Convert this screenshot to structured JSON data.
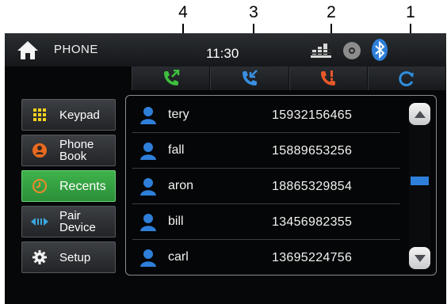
{
  "callouts": [
    {
      "number": "4",
      "target": "tab-dialed-calls"
    },
    {
      "number": "3",
      "target": "tab-received-calls"
    },
    {
      "number": "2",
      "target": "tab-missed-calls"
    },
    {
      "number": "1",
      "target": "tab-refresh"
    }
  ],
  "header": {
    "title": "PHONE",
    "time": "11:30",
    "icons": [
      "home-icon",
      "signal-icon",
      "disc-icon",
      "bluetooth-icon"
    ]
  },
  "tabs": [
    {
      "icon": "dialed-call-icon",
      "color": "#3fbf3f"
    },
    {
      "icon": "received-call-icon",
      "color": "#3a8fe0"
    },
    {
      "icon": "missed-call-icon",
      "color": "#e8582a"
    },
    {
      "icon": "refresh-icon",
      "color": "#2f8fe0"
    }
  ],
  "sidebar": {
    "items": [
      {
        "label": "Keypad",
        "icon": "keypad-icon",
        "active": false
      },
      {
        "label": "Phone\nBook",
        "icon": "phonebook-icon",
        "active": false
      },
      {
        "label": "Recents",
        "icon": "clock-icon",
        "active": true
      },
      {
        "label": "Pair\nDevice",
        "icon": "pair-icon",
        "active": false
      },
      {
        "label": "Setup",
        "icon": "gear-icon",
        "active": false
      }
    ]
  },
  "contacts": [
    {
      "name": "tery",
      "number": "15932156465"
    },
    {
      "name": "fall",
      "number": "15889653256"
    },
    {
      "name": "aron",
      "number": "18865329854"
    },
    {
      "name": "bill",
      "number": "13456982355"
    },
    {
      "name": "carl",
      "number": "13695224756"
    }
  ],
  "scroll": {
    "position_fraction": 0.45
  },
  "colors": {
    "accent_green": "#35a843",
    "accent_blue": "#2e7fd9",
    "background": "#060708"
  }
}
